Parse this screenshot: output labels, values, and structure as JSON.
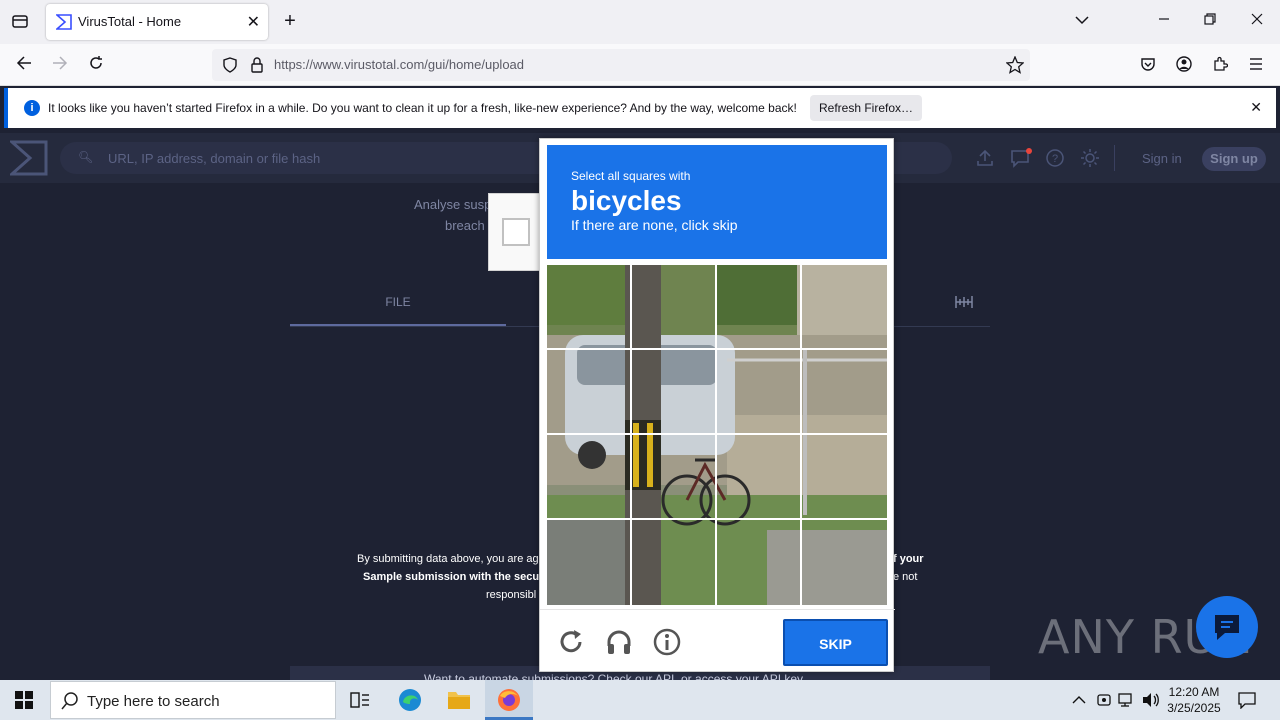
{
  "browser": {
    "tab_title": "VirusTotal - Home",
    "url": "https://www.virustotal.com/gui/home/upload",
    "notification": {
      "message": "It looks like you haven’t started Firefox in a while. Do you want to clean it up for a fresh, like-new experience? And by the way, welcome back!",
      "button": "Refresh Firefox…"
    }
  },
  "vt": {
    "search_placeholder": "URL, IP address, domain or file hash",
    "signin": "Sign in",
    "signup": "Sign up",
    "intro_line1": "Analyse susp",
    "intro_line2": "breach",
    "tab_file": "FILE",
    "terms_line1_left": "By submitting data above, you are ag",
    "terms_line1_right": "f your",
    "terms_line2_left": "Sample submission with the secur",
    "terms_line2_right": "e not",
    "terms_line3_left": "responsibl",
    "footer_text": "Want to automate submissions? Check our API, or access your API key."
  },
  "captcha": {
    "instruction": "Select all squares with",
    "target": "bicycles",
    "hint": "If there are none, click skip",
    "skip_label": "SKIP"
  },
  "watermark": "ANY RUN",
  "taskbar": {
    "search_placeholder": "Type here to search",
    "time": "12:20 AM",
    "date": "3/25/2025"
  }
}
